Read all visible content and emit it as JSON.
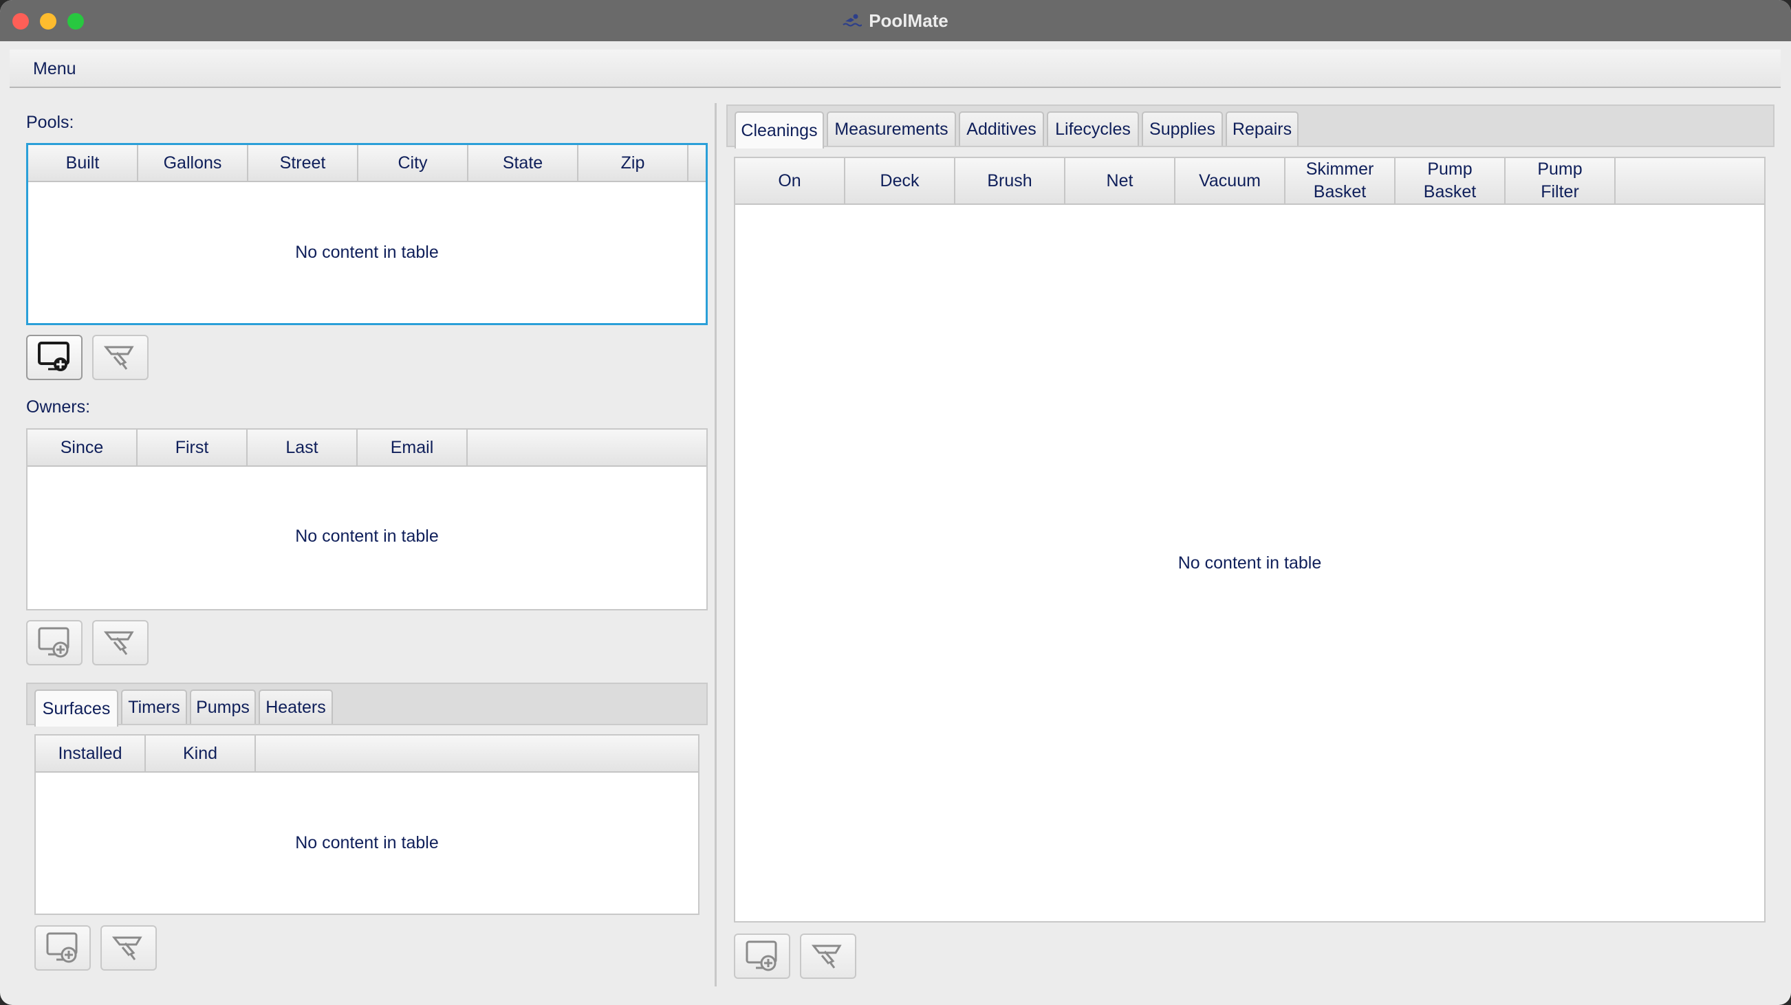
{
  "window": {
    "title": "PoolMate"
  },
  "menu": {
    "label": "Menu"
  },
  "pools": {
    "label": "Pools:",
    "columns": [
      "Built",
      "Gallons",
      "Street",
      "City",
      "State",
      "Zip"
    ],
    "empty": "No content in table"
  },
  "owners": {
    "label": "Owners:",
    "columns": [
      "Since",
      "First",
      "Last",
      "Email"
    ],
    "empty": "No content in table"
  },
  "pool_parts": {
    "tabs": [
      "Surfaces",
      "Timers",
      "Pumps",
      "Heaters"
    ],
    "selected_tab": "Surfaces",
    "columns": [
      "Installed",
      "Kind"
    ],
    "empty": "No content in table"
  },
  "maintenance": {
    "tabs": [
      "Cleanings",
      "Measurements",
      "Additives",
      "Lifecycles",
      "Supplies",
      "Repairs"
    ],
    "selected_tab": "Cleanings",
    "columns": [
      "On",
      "Deck",
      "Brush",
      "Net",
      "Vacuum",
      "Skimmer\nBasket",
      "Pump\nBasket",
      "Pump\nFilter"
    ],
    "empty": "No content in table"
  },
  "icons": {
    "add": "add-icon",
    "edit": "edit-icon"
  },
  "colors": {
    "text": "#0f1f5a",
    "focus": "#2a9fd8",
    "titlebar": "#6a6a6a"
  }
}
